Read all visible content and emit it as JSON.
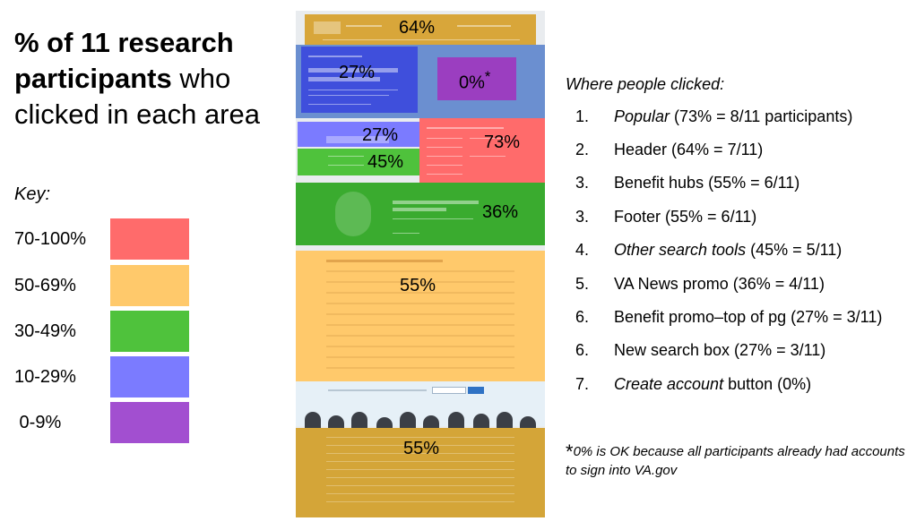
{
  "title": {
    "bold": "% of 11 research participants",
    "rest": " who clicked in each area"
  },
  "key": {
    "label": "Key:",
    "rows": [
      {
        "range": "70-100%",
        "color": "#ff6b6b"
      },
      {
        "range": "50-69%",
        "color": "#ffc96b"
      },
      {
        "range": "30-49%",
        "color": "#4fc23c"
      },
      {
        "range": "10-29%",
        "color": "#7b7bff"
      },
      {
        "range": " 0-9%",
        "color": "#a24fd0"
      }
    ]
  },
  "screenshot": {
    "regions": [
      {
        "name": "header",
        "label": "64%",
        "color": "#d8a63a"
      },
      {
        "name": "benefit-promo",
        "label": "27%",
        "color": "#3f4fdc"
      },
      {
        "name": "create-account",
        "label": "0%",
        "star": "*",
        "color": "#9b3ec0"
      },
      {
        "name": "search-box",
        "label": "27%",
        "color": "#7b7bff"
      },
      {
        "name": "popular",
        "label": "73%",
        "color": "#ff6b6b"
      },
      {
        "name": "other-search",
        "label": "45%",
        "color": "#4fc23c"
      },
      {
        "name": "news-promo",
        "label": "36%",
        "color": "#3aab2f"
      },
      {
        "name": "benefit-hubs",
        "label": "55%",
        "color": "#ffc96b"
      },
      {
        "name": "footer",
        "label": "55%",
        "color": "#d4a538"
      }
    ],
    "page_text": {
      "header_logo": "VA",
      "welcome": "Welcome to VA.gov",
      "search": "Search",
      "popular": "Popular on VA.gov",
      "news": "Pathfinder: The front door for engaging with VA",
      "explore": "Explore VA benefits and health care",
      "signup_button": "Signup",
      "email_line": "Sign up to get the latest VA updates. Sign up with your email address."
    }
  },
  "where": "Where people clicked:",
  "list": [
    {
      "num": "1.",
      "italic": "Popular",
      "text": " (73% = 8/11 participants)"
    },
    {
      "num": "2.",
      "italic": "",
      "text": "Header (64% = 7/11)"
    },
    {
      "num": "3.",
      "italic": "",
      "text": "Benefit hubs (55% = 6/11)"
    },
    {
      "num": "3.",
      "italic": "",
      "text": "Footer (55% = 6/11)"
    },
    {
      "num": "4.",
      "italic": "Other search tools",
      "text": " (45% = 5/11)"
    },
    {
      "num": "5.",
      "italic": "",
      "text": "VA News promo (36% = 4/11)"
    },
    {
      "num": "6.",
      "italic": "",
      "text": "Benefit promo–top of pg (27% = 3/11)"
    },
    {
      "num": "6.",
      "italic": "",
      "text": "New search box (27% = 3/11)"
    },
    {
      "num": "7.",
      "italic": "Create account",
      "text": " button (0%)"
    }
  ],
  "note": {
    "star": "*",
    "text": "0% is OK because all participants already had accounts to sign into VA.gov"
  }
}
